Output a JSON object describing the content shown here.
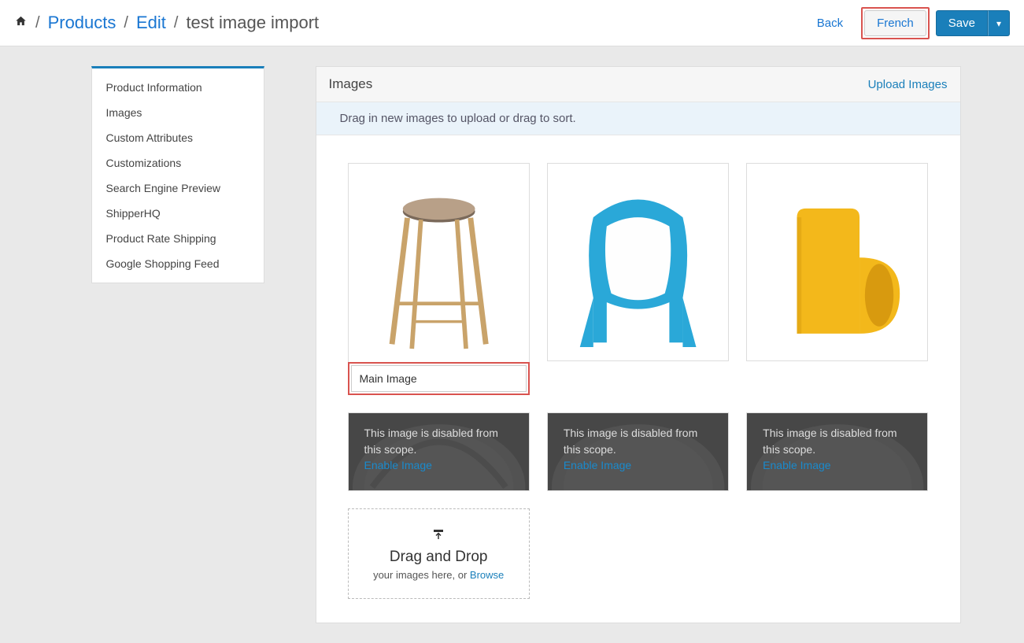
{
  "breadcrumb": {
    "products": "Products",
    "edit": "Edit",
    "title": "test image import"
  },
  "header_actions": {
    "back": "Back",
    "language": "French",
    "save": "Save"
  },
  "sidebar": {
    "items": [
      {
        "label": "Product Information"
      },
      {
        "label": "Images"
      },
      {
        "label": "Custom Attributes"
      },
      {
        "label": "Customizations"
      },
      {
        "label": "Search Engine Preview"
      },
      {
        "label": "ShipperHQ"
      },
      {
        "label": "Product Rate Shipping"
      },
      {
        "label": "Google Shopping Feed"
      }
    ]
  },
  "content": {
    "title": "Images",
    "upload_link": "Upload Images",
    "info": "Drag in new images to upload or drag to sort.",
    "main_image_label": "Main Image",
    "disabled_text": "This image is disabled from this scope.",
    "enable_link": "Enable Image",
    "dropzone": {
      "title": "Drag and Drop",
      "subtitle_prefix": "your images here, or ",
      "browse": "Browse"
    }
  }
}
